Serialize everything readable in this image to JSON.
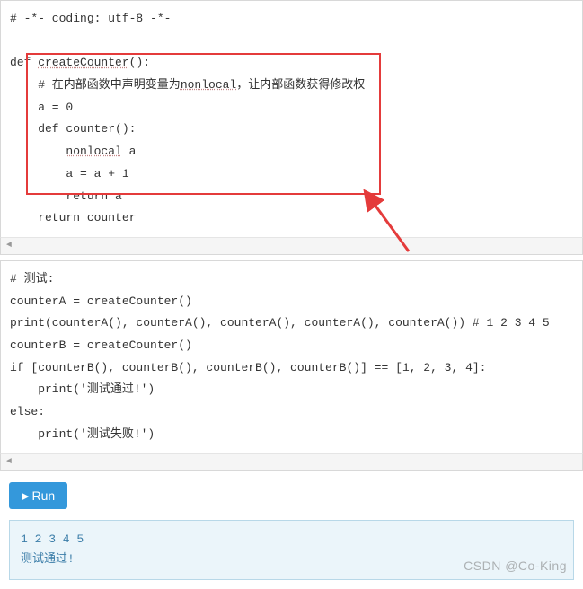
{
  "code1": {
    "l1": "# -*- coding: utf-8 -*-",
    "l2": "",
    "l3a": "def ",
    "l3b": "createCounter",
    "l3c": "():",
    "l4a": "    # 在内部函数中声明变量为",
    "l4b": "nonlocal",
    "l4c": "，让内部函数获得修改权",
    "l5": "    a = 0",
    "l6": "    def counter():",
    "l7a": "        ",
    "l7b": "nonlocal",
    "l7c": " a",
    "l8": "        a = a + 1",
    "l9": "        return a",
    "l10": "    return counter"
  },
  "code2": {
    "l1": "# 测试:",
    "l2": "counterA = createCounter()",
    "l3": "print(counterA(), counterA(), counterA(), counterA(), counterA()) # 1 2 3 4 5",
    "l4": "counterB = createCounter()",
    "l5": "if [counterB(), counterB(), counterB(), counterB()] == [1, 2, 3, 4]:",
    "l6": "    print('测试通过!')",
    "l7": "else:",
    "l8": "    print('测试失败!')"
  },
  "run": {
    "label": "Run"
  },
  "output": {
    "line1": "1 2 3 4 5",
    "line2": "测试通过!"
  },
  "watermark": "CSDN @Co-King"
}
